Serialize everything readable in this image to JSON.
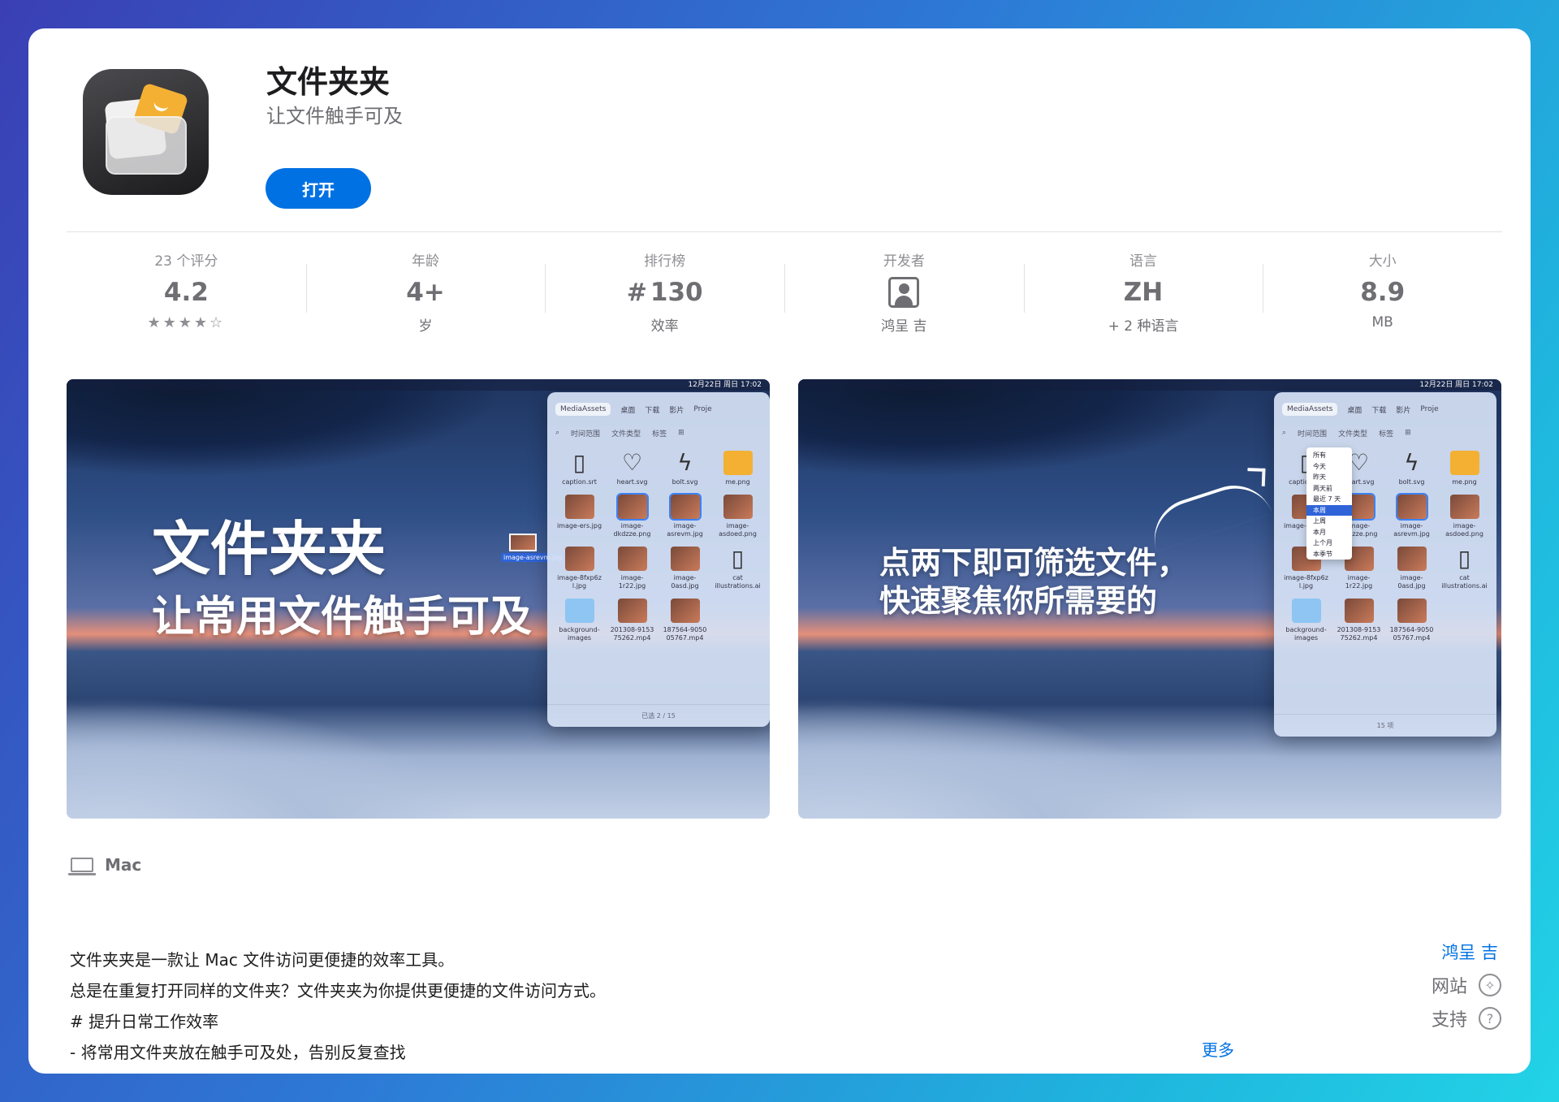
{
  "app": {
    "title": "文件夹夹",
    "subtitle": "让文件触手可及",
    "open_label": "打开"
  },
  "stats": [
    {
      "label": "23 个评分",
      "value": "4.2",
      "sub": "★★★★☆"
    },
    {
      "label": "年龄",
      "value": "4+",
      "sub": "岁"
    },
    {
      "label": "排行榜",
      "hash": "#",
      "value": "130",
      "sub": "效率"
    },
    {
      "label": "开发者",
      "value": "",
      "sub": "鸿呈 吉"
    },
    {
      "label": "语言",
      "value": "ZH",
      "sub": "+ 2 种语言"
    },
    {
      "label": "大小",
      "value": "8.9",
      "sub": "MB"
    }
  ],
  "screenshots": {
    "left": {
      "line1": "文件夹夹",
      "line2": "让常用文件触手可及",
      "menubar": "12月22日 周日 17:02",
      "drag_label": "image-asrevm.jpg"
    },
    "right": {
      "line1": "点两下即可筛选文件，",
      "line2": "快速聚焦你所需要的",
      "menubar": "12月22日 周日 17:02",
      "dropdown": [
        "所有",
        "今天",
        "昨天",
        "两天前",
        "最近 7 天",
        "本周",
        "上周",
        "本月",
        "上个月",
        "本季节"
      ]
    },
    "finder": {
      "tabs": [
        "MediaAssets",
        "桌面",
        "下载",
        "影片",
        "Proje"
      ],
      "filters": [
        "时间范围",
        "文件类型",
        "标签",
        "⊞"
      ],
      "files": [
        {
          "name": "caption.srt",
          "kind": "doc"
        },
        {
          "name": "heart.svg",
          "kind": "heart"
        },
        {
          "name": "bolt.svg",
          "kind": "bolt"
        },
        {
          "name": "me.png",
          "kind": "bunny"
        },
        {
          "name": "image-ers.jpg",
          "kind": "img"
        },
        {
          "name": "image-dkdzze.png",
          "kind": "img-sel"
        },
        {
          "name": "image-asrevm.jpg",
          "kind": "img-sel"
        },
        {
          "name": "image-asdoed.png",
          "kind": "img"
        },
        {
          "name": "image-8fxp6z l.jpg",
          "kind": "img"
        },
        {
          "name": "image-1r22.jpg",
          "kind": "img"
        },
        {
          "name": "image-0asd.jpg",
          "kind": "img"
        },
        {
          "name": "cat illustrations.ai",
          "kind": "doc"
        },
        {
          "name": "background-images",
          "kind": "folder"
        },
        {
          "name": "201308-9153 75262.mp4",
          "kind": "img"
        },
        {
          "name": "187564-9050 05767.mp4",
          "kind": "img"
        }
      ],
      "footer_left": "已选 2 / 15",
      "footer_right": "15 项"
    }
  },
  "platform": {
    "label": "Mac"
  },
  "description": {
    "lines": [
      "文件夹夹是一款让 Mac 文件访问更便捷的效率工具。",
      "总是在重复打开同样的文件夹？文件夹夹为你提供更便捷的文件访问方式。",
      "# 提升日常工作效率",
      "- 将常用文件夹放在触手可及处，告别反复查找"
    ],
    "more_label": "更多"
  },
  "sidebar": {
    "developer_link": "鸿呈 吉",
    "website_label": "网站",
    "support_label": "支持"
  }
}
